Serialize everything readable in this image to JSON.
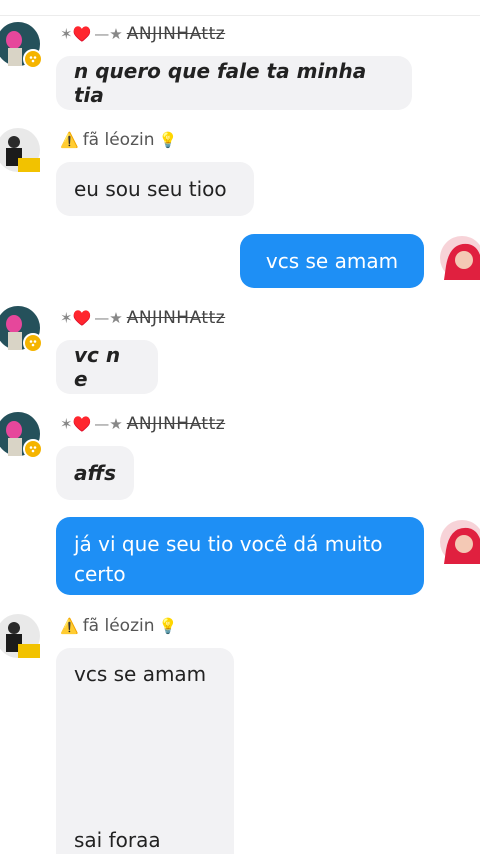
{
  "users": {
    "anjinha": {
      "prefix": "✶♥️ —★",
      "name": "ANJINHAttz"
    },
    "leozin": {
      "prefix": "⚠️",
      "name": "fã léozin",
      "suffix": "💡"
    }
  },
  "messages": [
    {
      "sender": "anjinha",
      "text": "n quero que fale ta minha tia"
    },
    {
      "sender": "leozin",
      "text": "eu sou seu tioo"
    },
    {
      "sender": "me",
      "text": "vcs se amam"
    },
    {
      "sender": "anjinha",
      "text": "vc n e"
    },
    {
      "sender": "anjinha",
      "text": "affs"
    },
    {
      "sender": "me",
      "line1": "já vi que seu tio você dá muito",
      "line2": "certo"
    },
    {
      "sender": "leozin",
      "line1": "vcs se amam",
      "line2": "sai foraa"
    }
  ],
  "colors": {
    "outgoing": "#1e8ff5",
    "incoming": "#f2f2f4",
    "badge": "#f5b400"
  }
}
